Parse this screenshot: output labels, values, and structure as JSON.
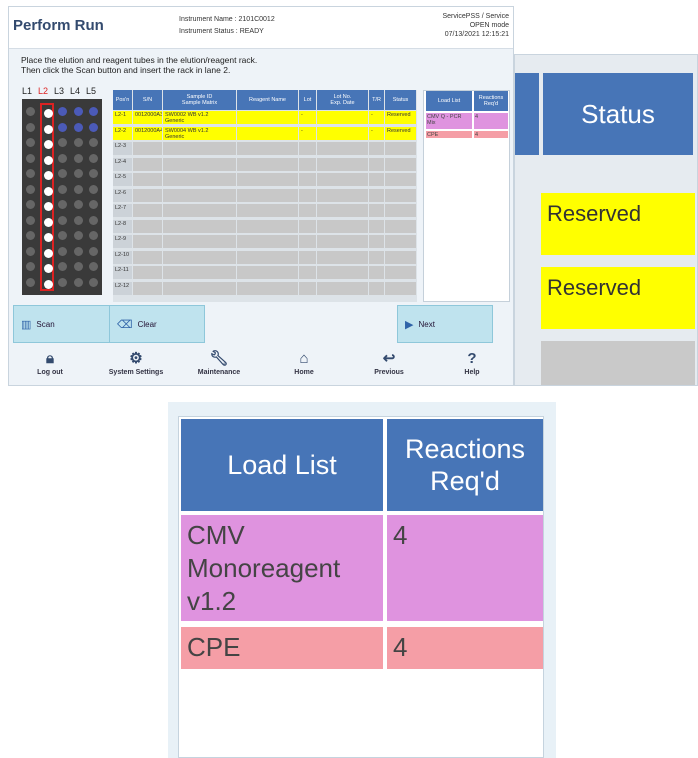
{
  "header": {
    "title": "Perform Run",
    "instrument_name": "Instrument Name : 2101C0012",
    "instrument_status": "Instrument Status : READY",
    "user": "ServicePSS / Service",
    "mode": "OPEN mode",
    "datetime": "07/13/2021 12:15:21"
  },
  "instructions": {
    "line1": "Place the elution and reagent tubes in the elution/reagent rack.",
    "line2": "Then click the Scan button and insert the rack in lane 2."
  },
  "lanes": {
    "labels": [
      "L1",
      "L2",
      "L3",
      "L4",
      "L5"
    ],
    "selected_label": "L2"
  },
  "table": {
    "headers": [
      "Pos'n",
      "S/N",
      "Sample ID\nSample Matrix",
      "Reagent Name",
      "Lot",
      "Lot No.\nExp. Date",
      "T/R",
      "Status"
    ],
    "rows": [
      {
        "pos": "L2-1",
        "sn": "0012000A3",
        "sample": "SW0002 WB v1.2\nGeneric",
        "reagent": "",
        "lot": "-",
        "lotno": "",
        "tr": "-",
        "status": "Reserved",
        "highlight": true
      },
      {
        "pos": "L2-2",
        "sn": "0012000A4",
        "sample": "SW0004 WB v1.2\nGeneric",
        "reagent": "",
        "lot": "-",
        "lotno": "",
        "tr": "-",
        "status": "Reserved",
        "highlight": true
      },
      {
        "pos": "L2-3"
      },
      {
        "pos": "L2-4"
      },
      {
        "pos": "L2-5"
      },
      {
        "pos": "L2-6"
      },
      {
        "pos": "L2-7"
      },
      {
        "pos": "L2-8"
      },
      {
        "pos": "L2-9"
      },
      {
        "pos": "L2-10"
      },
      {
        "pos": "L2-11"
      },
      {
        "pos": "L2-12"
      }
    ]
  },
  "load_list": {
    "headers": [
      "Load List",
      "Reactions\nReq'd"
    ],
    "items": [
      {
        "name": "CMV Monoreagent v1.2",
        "short_name": "CMV Q - PCR Mix",
        "reactions": "4",
        "color": "#df93df"
      },
      {
        "name": "CPE",
        "short_name": "CPE",
        "reactions": "4",
        "color": "#f59ea6"
      }
    ]
  },
  "buttons": {
    "scan": "Scan",
    "clear": "Clear",
    "next": "Next"
  },
  "bottom_nav": [
    "Log out",
    "System Settings",
    "Maintenance",
    "Home",
    "Previous",
    "Help"
  ],
  "zoom_status": {
    "header": "Status",
    "values": [
      "Reserved",
      "Reserved"
    ]
  },
  "colors": {
    "header_blue": "#4775b7",
    "highlight_yellow": "#ffff00",
    "button_cyan": "#bfe3ee"
  }
}
